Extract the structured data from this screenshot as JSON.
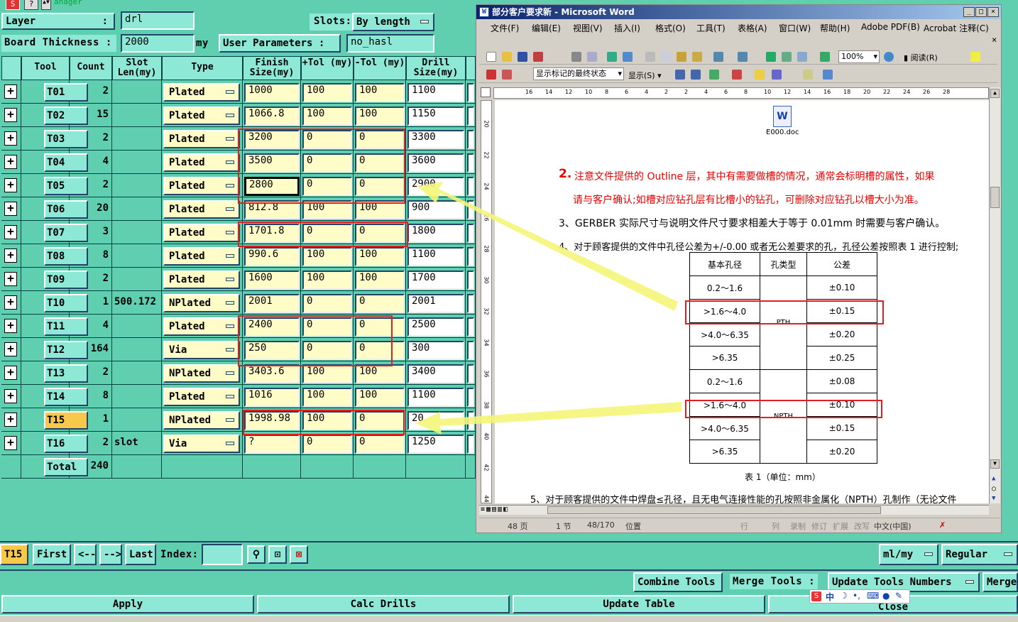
{
  "header": {
    "app_title_partial": "anager",
    "layer_label": "Layer",
    "layer_value": "drl",
    "slots_label": "Slots:",
    "slots_value": "By length",
    "board_thickness_label": "Board Thickness :",
    "board_thickness_value": "2000",
    "board_thickness_unit": "my",
    "user_params_label": "User Parameters :",
    "user_params_value": "no_hasl"
  },
  "table": {
    "headers": [
      "Tool",
      "Count",
      "Slot Len(my)",
      "Type",
      "Finish Size(my)",
      "+Tol (my)",
      "-Tol (my)",
      "Drill Size(my)"
    ],
    "rows": [
      {
        "tool": "T01",
        "count": "2",
        "slot": "",
        "type": "Plated",
        "finish": "1000",
        "ptol": "100",
        "ntol": "100",
        "drill": "1100"
      },
      {
        "tool": "T02",
        "count": "15",
        "slot": "",
        "type": "Plated",
        "finish": "1066.8",
        "ptol": "100",
        "ntol": "100",
        "drill": "1150"
      },
      {
        "tool": "T03",
        "count": "2",
        "slot": "",
        "type": "Plated",
        "finish": "3200",
        "ptol": "0",
        "ntol": "0",
        "drill": "3300"
      },
      {
        "tool": "T04",
        "count": "4",
        "slot": "",
        "type": "Plated",
        "finish": "3500",
        "ptol": "0",
        "ntol": "0",
        "drill": "3600"
      },
      {
        "tool": "T05",
        "count": "2",
        "slot": "",
        "type": "Plated",
        "finish": "2800",
        "ptol": "0",
        "ntol": "0",
        "drill": "2900"
      },
      {
        "tool": "T06",
        "count": "20",
        "slot": "",
        "type": "Plated",
        "finish": "812.8",
        "ptol": "100",
        "ntol": "100",
        "drill": "900"
      },
      {
        "tool": "T07",
        "count": "3",
        "slot": "",
        "type": "Plated",
        "finish": "1701.8",
        "ptol": "0",
        "ntol": "0",
        "drill": "1800"
      },
      {
        "tool": "T08",
        "count": "8",
        "slot": "",
        "type": "Plated",
        "finish": "990.6",
        "ptol": "100",
        "ntol": "100",
        "drill": "1100"
      },
      {
        "tool": "T09",
        "count": "2",
        "slot": "",
        "type": "Plated",
        "finish": "1600",
        "ptol": "100",
        "ntol": "100",
        "drill": "1700"
      },
      {
        "tool": "T10",
        "count": "1",
        "slot": "500.172",
        "type": "NPlated",
        "finish": "2001",
        "ptol": "0",
        "ntol": "0",
        "drill": "2001"
      },
      {
        "tool": "T11",
        "count": "4",
        "slot": "",
        "type": "Plated",
        "finish": "2400",
        "ptol": "0",
        "ntol": "0",
        "drill": "2500"
      },
      {
        "tool": "T12",
        "count": "164",
        "slot": "",
        "type": "Via",
        "finish": "250",
        "ptol": "0",
        "ntol": "0",
        "drill": "300"
      },
      {
        "tool": "T13",
        "count": "2",
        "slot": "",
        "type": "NPlated",
        "finish": "3403.6",
        "ptol": "100",
        "ntol": "100",
        "drill": "3400"
      },
      {
        "tool": "T14",
        "count": "8",
        "slot": "",
        "type": "Plated",
        "finish": "1016",
        "ptol": "100",
        "ntol": "100",
        "drill": "1100"
      },
      {
        "tool": "T15",
        "count": "1",
        "slot": "",
        "type": "NPlated",
        "finish": "1998.98",
        "ptol": "100",
        "ntol": "0",
        "drill": "20"
      },
      {
        "tool": "T16",
        "count": "2",
        "slot": "slot",
        "type": "Via",
        "finish": "?",
        "ptol": "0",
        "ntol": "0",
        "drill": "1250"
      }
    ],
    "total_label": "Total",
    "total_value": "240"
  },
  "nav": {
    "current_tool": "T15",
    "first": "First",
    "prev": "<--",
    "next": "-->",
    "last": "Last",
    "index_label": "Index:",
    "units": "ml/my",
    "mode": "Regular"
  },
  "actions": {
    "combine_tools": "Combine Tools",
    "merge_tools_label": "Merge Tools :",
    "update_tools_numbers": "Update Tools Numbers",
    "merge": "Merge",
    "apply": "Apply",
    "calc_drills": "Calc Drills",
    "update_table": "Update Table",
    "close": "Close"
  },
  "word": {
    "title": "部分客户要求新 - Microsoft Word",
    "menus": [
      "文件(F)",
      "编辑(E)",
      "视图(V)",
      "插入(I)",
      "格式(O)",
      "工具(T)",
      "表格(A)",
      "窗口(W)",
      "帮助(H)",
      "Adobe PDF(B)",
      "Acrobat 注释(C)"
    ],
    "zoom": "100%",
    "read_btn": "阅读(R)",
    "markup_state": "显示标记的最终状态",
    "show_btn": "显示(S)",
    "embedded_file": "E000.doc",
    "para2_num": "2.",
    "para2_line1": "注意文件提供的 Outline 层，其中有需要做槽的情况，通常会标明槽的属性，如果",
    "para2_line2": "请与客户确认;如槽对应钻孔层有比槽小的钻孔，可删除对应钻孔以槽大小为准。",
    "para3": "3、GERBER 实际尺寸与说明文件尺寸要求相差大于等于 0.01mm 时需要与客户确认。",
    "para4": "4、对于顾客提供的文件中孔径公差为+/-0.00 或者无公差要求的孔，孔径公差按照表 1 进行控制;",
    "tbl_headers": [
      "基本孔径",
      "孔类型",
      "公差"
    ],
    "tbl_rows": [
      {
        "size": "0.2～1.6",
        "tol": "±0.10"
      },
      {
        "size": ">1.6～4.0",
        "tol": "±0.15"
      },
      {
        "size": ">4.0～6.35",
        "tol": "±0.20"
      },
      {
        "size": ">6.35",
        "tol": "±0.25"
      },
      {
        "size": "0.2～1.6",
        "tol": "±0.08"
      },
      {
        "size": ">1.6～4.0",
        "tol": "±0.10"
      },
      {
        "size": ">4.0～6.35",
        "tol": "±0.15"
      },
      {
        "size": ">6.35",
        "tol": "±0.20"
      }
    ],
    "pth": "PTH",
    "npth": "NPTH",
    "tbl_caption": "表 1（单位：mm）",
    "para5": "5、对于顾客提供的文件中焊盘≤孔径，且无电气连接性能的孔按照非金属化（NPTH）孔制作（无论文件",
    "status": {
      "page": "48 页",
      "section": "1 节",
      "pages": "48/170",
      "position": "位置",
      "row": "行",
      "col": "列",
      "rec": "录制",
      "rev": "修订",
      "ext": "扩展",
      "ovr": "改写",
      "lang": "中文(中国)"
    },
    "ruler_h": [
      "16",
      "14",
      "12",
      "10",
      "8",
      "6",
      "4",
      "2",
      "2",
      "4",
      "6",
      "8",
      "10",
      "12",
      "14",
      "16",
      "18",
      "20",
      "22",
      "24",
      "26",
      "28"
    ],
    "ruler_v": [
      "20",
      "22",
      "24",
      "26",
      "28",
      "30",
      "32",
      "34",
      "36",
      "38",
      "40",
      "42",
      "44"
    ]
  },
  "ime": {
    "label": "中"
  }
}
